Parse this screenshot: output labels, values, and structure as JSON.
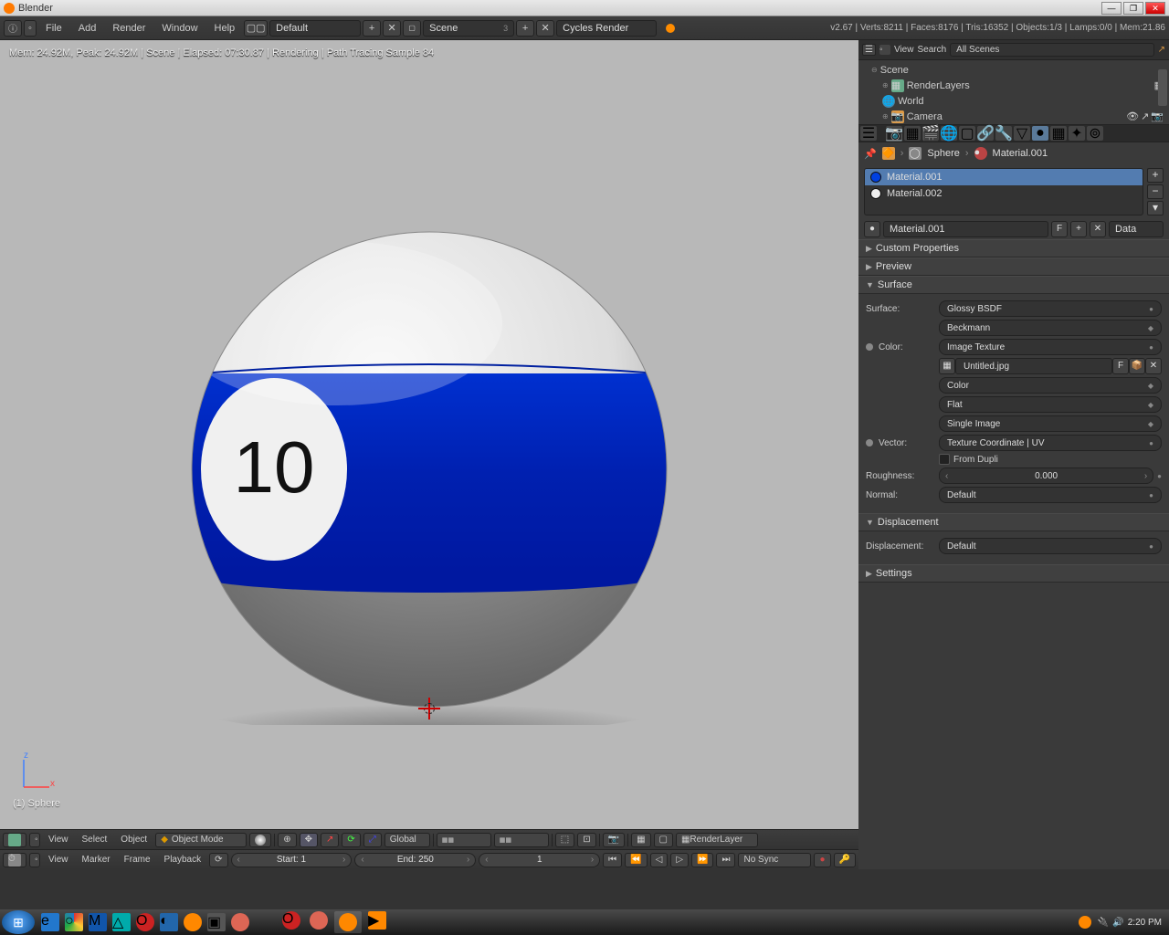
{
  "titlebar": {
    "title": "Blender"
  },
  "topmenu": {
    "items": [
      "File",
      "Add",
      "Render",
      "Window",
      "Help"
    ],
    "layout": "Default",
    "scene": "Scene",
    "engine": "Cycles Render",
    "stats": "v2.67 | Verts:8211 | Faces:8176 | Tris:16352 | Objects:1/3 | Lamps:0/0 | Mem:21.86"
  },
  "render": {
    "info": "Mem: 24.92M, Peak: 24.92M | Scene | Elapsed: 07:30.87 | Rendering | Path Tracing Sample 84",
    "object_label": "(1) Sphere",
    "ball_number": "10"
  },
  "viewport_bar": {
    "menus": [
      "View",
      "Select",
      "Object"
    ],
    "mode": "Object Mode",
    "orientation": "Global",
    "layer": "RenderLayer"
  },
  "timeline": {
    "menus": [
      "View",
      "Marker",
      "Frame",
      "Playback"
    ],
    "start_label": "Start: 1",
    "end_label": "End: 250",
    "current": "1",
    "sync": "No Sync"
  },
  "outliner": {
    "header_view": "View",
    "header_search": "Search",
    "filter": "All Scenes",
    "scene": "Scene",
    "items": [
      "RenderLayers",
      "World",
      "Camera"
    ]
  },
  "breadcrumb": {
    "obj": "Sphere",
    "mat": "Material.001"
  },
  "materials": {
    "slots": [
      "Material.001",
      "Material.002"
    ],
    "selected": "Material.001",
    "f": "F",
    "link": "Data"
  },
  "panels": {
    "custom_props": "Custom Properties",
    "preview": "Preview",
    "surface": "Surface",
    "displacement": "Displacement",
    "settings": "Settings"
  },
  "surface": {
    "surface_label": "Surface:",
    "surface_value": "Glossy BSDF",
    "distribution": "Beckmann",
    "color_label": "Color:",
    "color_value": "Image Texture",
    "image_name": "Untitled.jpg",
    "img_f": "F",
    "colorspace": "Color",
    "projection": "Flat",
    "interp": "Single Image",
    "vector_label": "Vector:",
    "vector_value": "Texture Coordinate | UV",
    "from_dupli": "From Dupli",
    "roughness_label": "Roughness:",
    "roughness_value": "0.000",
    "normal_label": "Normal:",
    "normal_value": "Default"
  },
  "displacement": {
    "label": "Displacement:",
    "value": "Default"
  },
  "taskbar": {
    "time": "2:20 PM"
  }
}
